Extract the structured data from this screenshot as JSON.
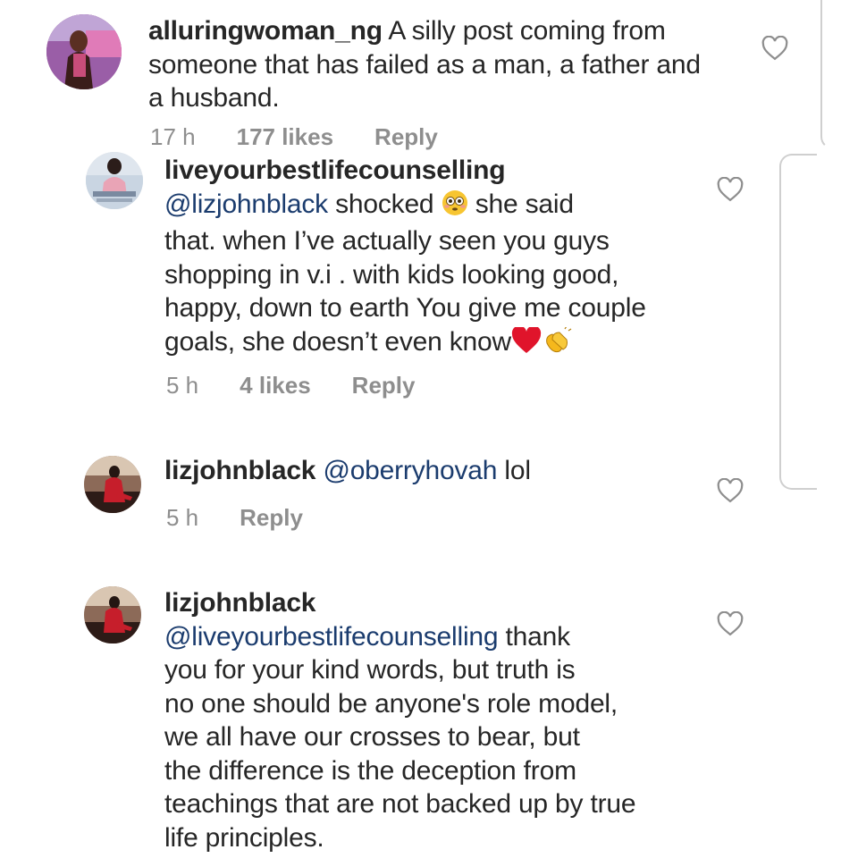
{
  "comments": [
    {
      "username": "alluringwoman_ng",
      "text_lines": [
        "A silly post coming from",
        "someone that has failed as a man, a father and",
        "a husband."
      ],
      "time": "17 h",
      "likes": "177 likes",
      "reply": "Reply"
    },
    {
      "username": "liveyourbestlifecounselling",
      "mention": "@lizjohnblack",
      "text_part1": "shocked",
      "text_part2": "she said",
      "text_lines": [
        "that. when I’ve actually seen you guys",
        "shopping in v.i . with kids looking good,",
        "happy, down to earth You give me couple",
        "goals, she doesn’t even know"
      ],
      "time": "5 h",
      "likes": "4 likes",
      "reply": "Reply"
    },
    {
      "username": "lizjohnblack",
      "mention": "@oberryhovah",
      "text": "lol",
      "time": "5 h",
      "reply": "Reply"
    },
    {
      "username": "lizjohnblack",
      "mention": "@liveyourbestlifecounselling",
      "text_first": "thank",
      "text_lines": [
        "you for your kind words, but truth is",
        "no one should be anyone's role model,",
        "we all have our crosses to bear, but",
        "the difference is the deception from",
        "teachings that are not backed up by true",
        "life principles."
      ]
    }
  ],
  "icons": {
    "heart": "heart-outline-icon",
    "flushed": "flushed-face-emoji",
    "red_heart": "red-heart-emoji",
    "clap": "clapping-hands-emoji"
  },
  "colors": {
    "text": "#262626",
    "mention": "#1b3c6e",
    "meta": "#8e8e8e",
    "heart_emoji": "#e0142b",
    "clap_emoji": "#f5b81c"
  }
}
